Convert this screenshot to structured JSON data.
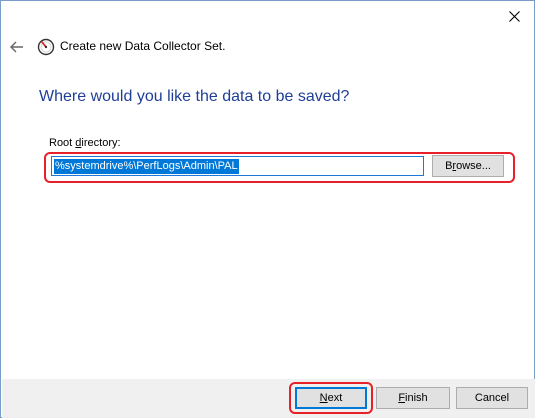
{
  "window": {
    "title": "Create new Data Collector Set.",
    "close_icon": "close-icon",
    "back_icon": "back-arrow-icon",
    "app_icon": "performance-monitor-icon"
  },
  "page": {
    "heading": "Where would you like the data to be saved?",
    "root_directory_label": "Root directory:",
    "root_directory_value": "%systemdrive%\\PerfLogs\\Admin\\PAL",
    "browse_label": "Browse..."
  },
  "footer": {
    "next_label": "Next",
    "finish_label": "Finish",
    "cancel_label": "Cancel"
  },
  "colors": {
    "heading": "#1f3f96",
    "selection": "#0078d7",
    "highlight": "#e8202a",
    "footer_bg": "#f0f0f0"
  }
}
